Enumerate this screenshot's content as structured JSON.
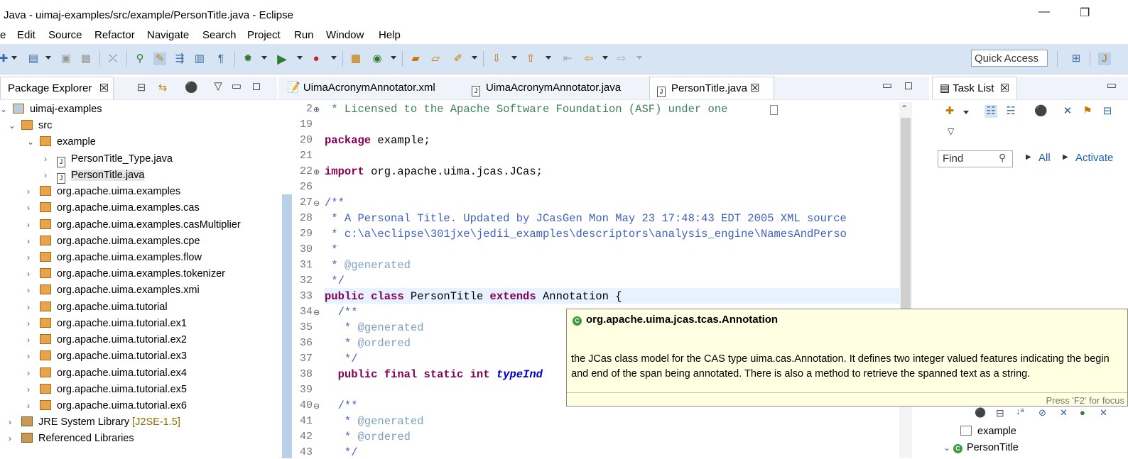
{
  "window": {
    "title": "Java - uimaj-examples/src/example/PersonTitle.java - Eclipse",
    "minimize": "—",
    "restore": "❐"
  },
  "menu": [
    "e",
    "Edit",
    "Source",
    "Refactor",
    "Navigate",
    "Search",
    "Project",
    "Run",
    "Window",
    "Help"
  ],
  "toolbar": {
    "quick_access": "Quick Access"
  },
  "package_explorer": {
    "tab_label": "Package Explorer",
    "tree": [
      {
        "label": "uimaj-examples",
        "extra": ""
      },
      {
        "label": "src",
        "extra": ""
      },
      {
        "label": "example",
        "extra": ""
      },
      {
        "label": "PersonTitle_Type.java",
        "extra": ""
      },
      {
        "label": "PersonTitle.java",
        "extra": ""
      },
      {
        "label": "org.apache.uima.examples",
        "extra": ""
      },
      {
        "label": "org.apache.uima.examples.cas",
        "extra": ""
      },
      {
        "label": "org.apache.uima.examples.casMultiplier",
        "extra": ""
      },
      {
        "label": "org.apache.uima.examples.cpe",
        "extra": ""
      },
      {
        "label": "org.apache.uima.examples.flow",
        "extra": ""
      },
      {
        "label": "org.apache.uima.examples.tokenizer",
        "extra": ""
      },
      {
        "label": "org.apache.uima.examples.xmi",
        "extra": ""
      },
      {
        "label": "org.apache.uima.tutorial",
        "extra": ""
      },
      {
        "label": "org.apache.uima.tutorial.ex1",
        "extra": ""
      },
      {
        "label": "org.apache.uima.tutorial.ex2",
        "extra": ""
      },
      {
        "label": "org.apache.uima.tutorial.ex3",
        "extra": ""
      },
      {
        "label": "org.apache.uima.tutorial.ex4",
        "extra": ""
      },
      {
        "label": "org.apache.uima.tutorial.ex5",
        "extra": ""
      },
      {
        "label": "org.apache.uima.tutorial.ex6",
        "extra": ""
      },
      {
        "label": "JRE System Library",
        "extra": "[J2SE-1.5]"
      },
      {
        "label": "Referenced Libraries",
        "extra": ""
      }
    ]
  },
  "editor": {
    "tabs": [
      {
        "label": "UimaAcronymAnnotator.xml"
      },
      {
        "label": "UimaAcronymAnnotator.java"
      },
      {
        "label": "PersonTitle.java",
        "close": "☒"
      }
    ],
    "line_numbers": [
      "2",
      "19",
      "20",
      "21",
      "22",
      "26",
      "27",
      "28",
      "29",
      "30",
      "31",
      "32",
      "33",
      "34",
      "35",
      "36",
      "37",
      "38",
      "39",
      "40",
      "41",
      "42",
      "43"
    ],
    "code": {
      "l2": " * Licensed to the Apache Software Foundation (ASF) under one",
      "l20a": "package",
      "l20b": " example;",
      "l22a": "import",
      "l22b": " org.apache.uima.jcas.JCas;",
      "l27": "/**",
      "l28": " * A Personal Title. Updated by JCasGen Mon May 23 17:48:43 EDT 2005 XML source",
      "l29": " * c:\\a\\eclipse\\301jxe\\jedii_examples\\descriptors\\analysis_engine\\NamesAndPerso",
      "l30": " *",
      "l31a": " * ",
      "l31b": "@generated",
      "l32": " */",
      "l33a": "public class",
      "l33b": " PersonTitle ",
      "l33c": "extends",
      "l33d": " Annotation {",
      "l34": "  /**",
      "l35a": "   * ",
      "l35b": "@generated",
      "l36a": "   * ",
      "l36b": "@ordered",
      "l37": "   */",
      "l38a": "  public final static int",
      "l38b": " typeInd",
      "l40": "  /**",
      "l41a": "   * ",
      "l41b": "@generated",
      "l42a": "   * ",
      "l42b": "@ordered",
      "l43": "   */"
    }
  },
  "hover": {
    "title": "org.apache.uima.jcas.tcas.Annotation",
    "body": "the JCas class model for the CAS type uima.cas.Annotation. It defines two integer valued features indicating the begin and end of the span being annotated. There is also a method to retrieve the spanned text as a string.",
    "footer": "Press 'F2' for focus"
  },
  "task_list": {
    "tab_label": "Task List",
    "find_placeholder": "Find",
    "all_label": "All",
    "activate_label": "Activate",
    "outline_items": [
      {
        "label": "example"
      },
      {
        "label": "PersonTitle"
      }
    ]
  }
}
